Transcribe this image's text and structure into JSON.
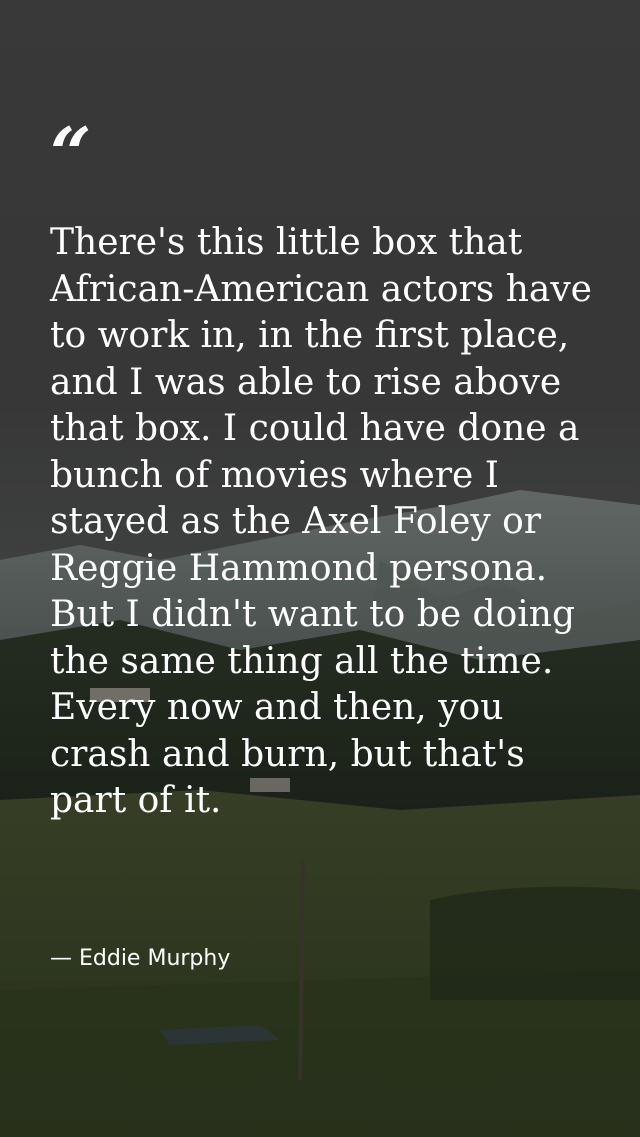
{
  "quote": {
    "mark": "“",
    "text": "There's this little box that African-American actors have to work in, in the first place, and I was able to rise above that box. I could have done a bunch of movies where I stayed as the Axel Foley or Reggie Hammond persona. But I didn't want to be doing the same thing all the time. Every now and then, you crash and burn, but that's part of it.",
    "attribution": "— Eddie Murphy"
  },
  "colors": {
    "text": "#ffffff",
    "sky": "#4a4a4a",
    "mountains": "#7f8a86",
    "grass": "#3b4a24"
  }
}
